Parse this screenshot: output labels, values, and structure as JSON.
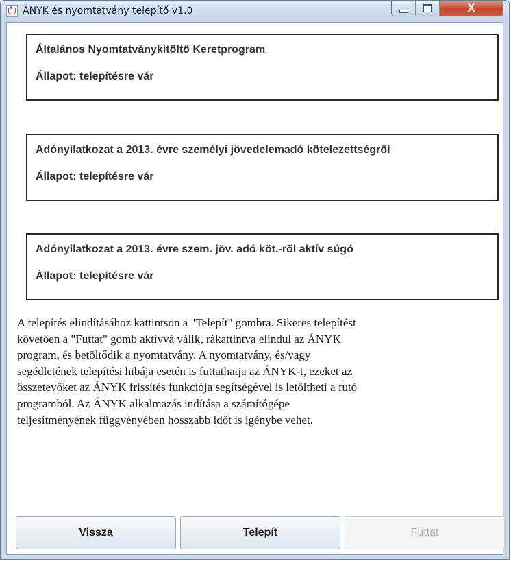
{
  "window": {
    "title": "ÁNYK és nyomtatvány telepítő v1.0",
    "close_glyph": "X",
    "icons": {
      "app": "java-cup-icon",
      "minimize": "minimize-icon",
      "maximize": "maximize-icon",
      "close": "close-icon"
    }
  },
  "components": [
    {
      "name": "Általános Nyomtatványkitöltő Keretprogram",
      "status": "Állapot: telepítésre vár"
    },
    {
      "name": "Adónyilatkozat a 2013. évre személyi jövedelemadó kötelezettségről",
      "status": "Állapot: telepítésre vár"
    },
    {
      "name": "Adónyilatkozat a 2013. évre szem.  jöv.  adó köt.-ről aktív súgó",
      "status": "Állapot: telepítésre vár"
    }
  ],
  "description_lines": [
    "A telepítés elindításához kattintson a \"Telepít\" gombra. Sikeres telepítést",
    "követően a \"Futtat\" gomb aktívvá válik, rákattintva elindul az ÁNYK",
    "program, és betöltődik a nyomtatvány. A nyomtatvány, és/vagy",
    "segédletének telepítési hibája esetén is futtathatja az ÁNYK-t, ezeket az",
    "összetevőket az ÁNYK frissítés funkciója segítségével is letöltheti a futó",
    "programból. Az ÁNYK alkalmazás indítása a számítógépe",
    "teljesítményének függvényében hosszabb időt is igénybe vehet."
  ],
  "buttons": {
    "back": "Vissza",
    "install": "Telepít",
    "run": "Futtat",
    "run_enabled": false
  }
}
